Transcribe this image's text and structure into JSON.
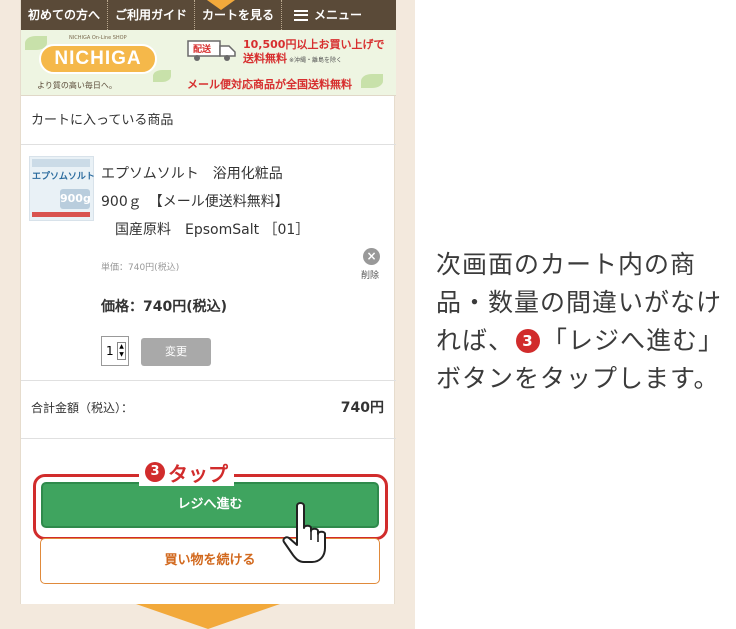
{
  "nav": {
    "first_time": "初めての方へ",
    "guide": "ご利用ガイド",
    "view_cart": "カートを見る",
    "menu": "メニュー"
  },
  "banner": {
    "logo": "NICHIGA",
    "logo_sub": "NICHIGA On-Line SHOP",
    "tagline": "より質の高い毎日へ。",
    "truck_label": "配送",
    "ship_line1": "10,500円以上お買い上げで",
    "ship_line2": "送料無料",
    "ship_note": "※沖縄・離島を除く",
    "ship_line3": "メール便対応商品が全国送料無料"
  },
  "cart": {
    "heading": "カートに入っている商品",
    "product": {
      "thumb_label": "エプソムソルト",
      "thumb_size": "900g",
      "name_lines": [
        "エプソムソルト　浴用化粧品",
        "900ｇ　【メール便送料無料】",
        "　国産原料　EpsomSalt ［01］"
      ],
      "unit_price": "単価：740円(税込)",
      "delete_label": "削除",
      "price": "価格：740円(税込)",
      "quantity": "1",
      "change_label": "変更"
    },
    "total_label": "合計金額（税込）：",
    "total_value": "740円"
  },
  "buttons": {
    "register": "レジへ進む",
    "continue": "買い物を続ける"
  },
  "callout": {
    "num": "3",
    "text": "タップ"
  },
  "instruction": {
    "part1": "次画面のカート内の商品・数量の間違いがなければ、",
    "num": "3",
    "part2": "「レジへ進む」ボタンをタップします。"
  },
  "colors": {
    "nav_bg": "#5a4a38",
    "accent_orange": "#f2a93b",
    "register_green": "#3fa45f",
    "highlight_red": "#d12c2c",
    "page_bg": "#f3e9dd"
  }
}
